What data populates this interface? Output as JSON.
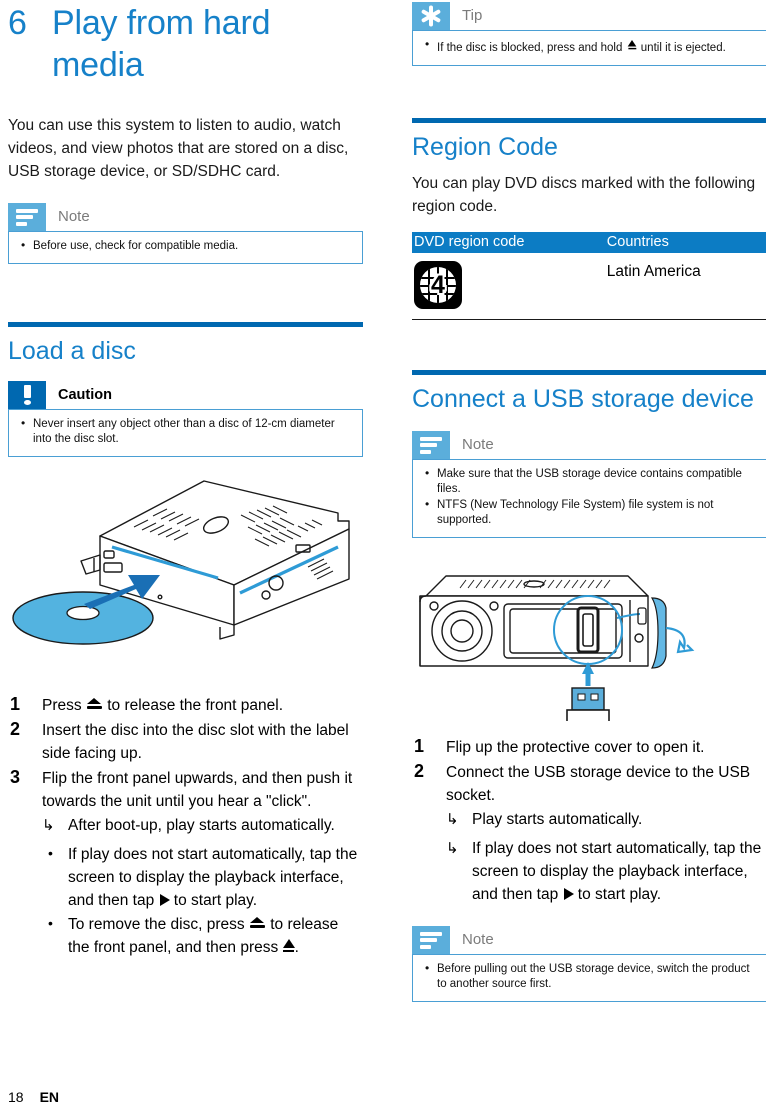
{
  "document": {
    "chapter_number": "6",
    "chapter_title": "Play from hard media",
    "intro": "You can use this system to listen to audio, watch videos, and view photos that are stored on a disc, USB storage device, or SD/SDHC card.",
    "footer": {
      "page_number": "18",
      "language": "EN"
    }
  },
  "colors": {
    "accent_blue": "#1681C9",
    "rule_blue": "#0068B0",
    "callout_blue": "#5BAEDB",
    "caution_blue": "#0068B0",
    "table_header_blue": "#0C7CC4",
    "illustration_blue": "#2E9BD6"
  },
  "callouts": {
    "note_media": {
      "icon": "note-lines-icon",
      "label": "Note",
      "items": [
        "Before use, check for compatible media."
      ]
    },
    "caution_disc": {
      "icon": "exclamation-icon",
      "label": "Caution",
      "items": [
        "Never insert any object other than a disc of 12-cm diameter into the disc slot."
      ]
    },
    "tip_disc": {
      "icon": "asterisk-icon",
      "label": "Tip",
      "items_prefix": "If the disc is blocked, press and hold ",
      "items_suffix": " until it is ejected."
    },
    "note_usb": {
      "icon": "note-lines-icon",
      "label": "Note",
      "items": [
        "Make sure that the USB storage device contains compatible files.",
        "NTFS (New Technology File System) file system is not supported."
      ]
    },
    "note_usb_remove": {
      "icon": "note-lines-icon",
      "label": "Note",
      "items": [
        "Before pulling out the USB storage device, switch the product to another source first."
      ]
    }
  },
  "sections": {
    "load_disc": {
      "heading": "Load a disc",
      "steps": [
        {
          "prefix": "Press ",
          "glyph": "eject-wide-icon",
          "suffix": " to release the front panel."
        },
        {
          "text": "Insert the disc into the disc slot with the label side facing up."
        },
        {
          "text": "Flip the front panel upwards, and then push it towards the unit until you hear a \"click\"."
        }
      ],
      "results": [
        "After boot-up, play starts automatically."
      ],
      "subbullets": [
        {
          "prefix": "If play does not start automatically, tap the screen to display the playback interface, and then tap ",
          "glyph": "play-icon",
          "suffix": " to start play."
        },
        {
          "prefix": "To remove the disc, press ",
          "glyph": "eject-wide-icon",
          "mid": " to release the front panel, and then press ",
          "glyph2": "eject-tall-icon",
          "suffix": "."
        }
      ],
      "illustration": "disc-drive-insert-illustration"
    },
    "region_code": {
      "heading": "Region Code",
      "intro": "You can play DVD discs marked with the following region code.",
      "table": {
        "headers": [
          "DVD region code",
          "Countries"
        ],
        "rows": [
          {
            "code_glyph": "region-4-globe-icon",
            "code_number": "4",
            "country": "Latin America"
          }
        ]
      }
    },
    "connect_usb": {
      "heading": "Connect a USB storage device",
      "steps": [
        {
          "text": "Flip up the protective cover to open it."
        },
        {
          "text": "Connect the USB storage device to the USB socket."
        }
      ],
      "results": [
        {
          "text": "Play starts automatically."
        },
        {
          "prefix": "If play does not start automatically, tap the screen to display the playback interface, and then tap ",
          "glyph": "play-icon",
          "suffix": " to start play."
        }
      ],
      "illustration": "usb-socket-insert-illustration"
    }
  }
}
